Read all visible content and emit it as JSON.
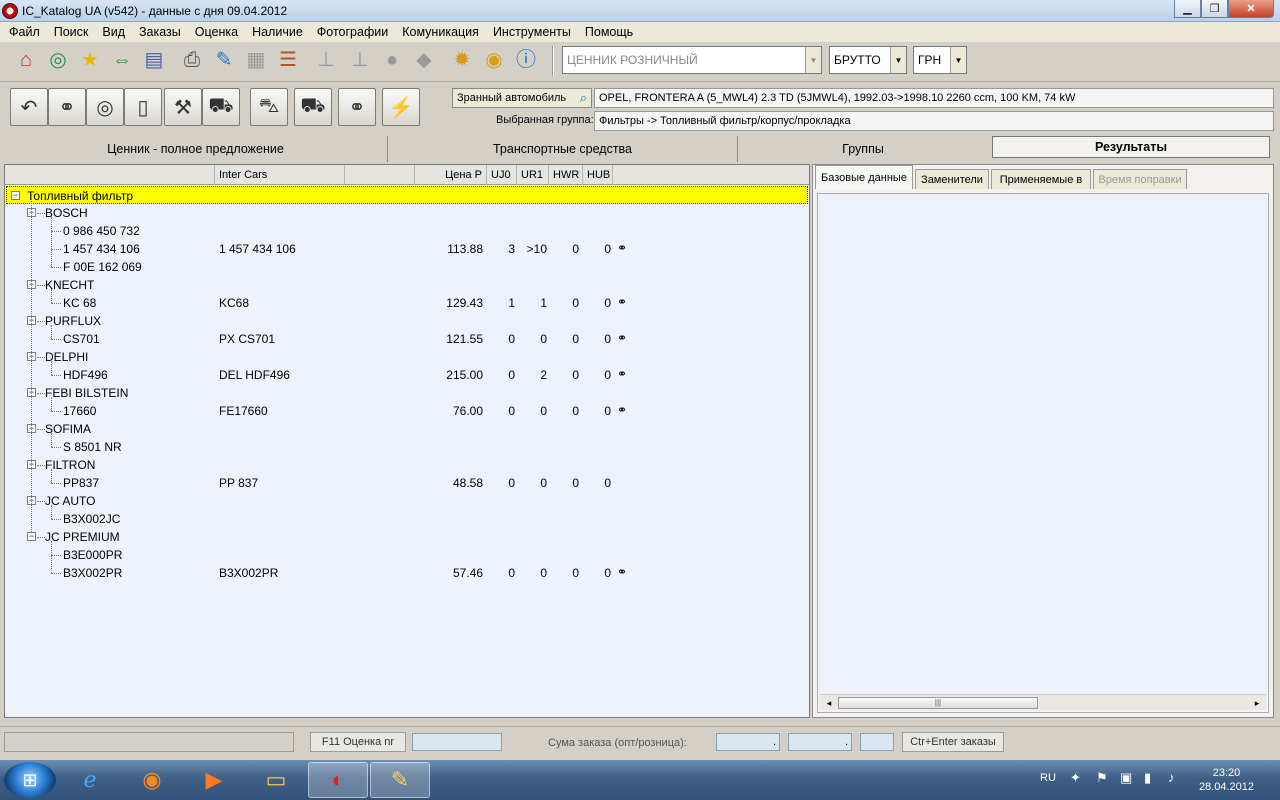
{
  "window": {
    "title": "IC_Katalog UA (v542) - данные с дня 09.04.2012"
  },
  "menu": [
    "Файл",
    "Поиск",
    "Вид",
    "Заказы",
    "Оценка",
    "Наличие",
    "Фотографии",
    "Комуникация",
    "Инструменты",
    "Помощь"
  ],
  "toolbar1": {
    "icons": [
      "home-icon",
      "refresh-globe-icon",
      "star-icon",
      "arrows-icon",
      "document-icon",
      "printer-icon",
      "pen-icon",
      "puzzle-icon",
      "notes-icon",
      "pin-icon",
      "pin-icon",
      "bubble-icon",
      "cart-icon",
      "gear-icon",
      "coins-icon",
      "info-icon"
    ],
    "price_list": "ЦЕННИК РОЗНИЧНЫЙ",
    "gross": "БРУТТО",
    "currency": "ГРН"
  },
  "vehicle": {
    "button_label": "Зранный автомобиль",
    "value": "OPEL, FRONTERA A (5_MWL4)  2.3 TD (5JMWL4), 1992.03->1998.10  2260 ccm, 100 KM, 74 kW",
    "group_label": "Выбранная группа:",
    "group_value": "Фильтры -> Топливный фильтр/корпус/прокладка"
  },
  "main_tabs": [
    "Ценник - полное предложение",
    "Транспортные средства",
    "Группы",
    "Результаты"
  ],
  "columns": {
    "c1": "",
    "inter_cars": "Inter Cars",
    "c3": "",
    "price": "Цена Р",
    "uj0": "UJ0",
    "ur1": "UR1",
    "hwr": "HWR",
    "hub": "HUB"
  },
  "tree": {
    "root": "Топливный фильтр",
    "rows": [
      {
        "type": "brand",
        "label": "BOSCH"
      },
      {
        "type": "item",
        "label": "0 986 450 732",
        "ic": "",
        "price": "",
        "uj0": "",
        "ur1": "",
        "hwr": "",
        "hub": "",
        "bino": false
      },
      {
        "type": "item",
        "label": "1 457 434 106",
        "ic": "1 457 434 106",
        "price": "113.88",
        "uj0": "3",
        "ur1": ">10",
        "hwr": "0",
        "hub": "0",
        "bino": true
      },
      {
        "type": "item",
        "label": "F 00E 162 069",
        "ic": "",
        "price": "",
        "uj0": "",
        "ur1": "",
        "hwr": "",
        "hub": "",
        "bino": false
      },
      {
        "type": "brand",
        "label": "KNECHT"
      },
      {
        "type": "item",
        "label": "KC 68",
        "ic": "KC68",
        "price": "129.43",
        "uj0": "1",
        "ur1": "1",
        "hwr": "0",
        "hub": "0",
        "bino": true
      },
      {
        "type": "brand",
        "label": "PURFLUX"
      },
      {
        "type": "item",
        "label": "CS701",
        "ic": "PX CS701",
        "price": "121.55",
        "uj0": "0",
        "ur1": "0",
        "hwr": "0",
        "hub": "0",
        "bino": true
      },
      {
        "type": "brand",
        "label": "DELPHI"
      },
      {
        "type": "item",
        "label": "HDF496",
        "ic": "DEL HDF496",
        "price": "215.00",
        "uj0": "0",
        "ur1": "2",
        "hwr": "0",
        "hub": "0",
        "bino": true
      },
      {
        "type": "brand",
        "label": "FEBI BILSTEIN"
      },
      {
        "type": "item",
        "label": "17660",
        "ic": "FE17660",
        "price": "76.00",
        "uj0": "0",
        "ur1": "0",
        "hwr": "0",
        "hub": "0",
        "bino": true
      },
      {
        "type": "brand",
        "label": "SOFIMA"
      },
      {
        "type": "item",
        "label": "S 8501 NR",
        "ic": "",
        "price": "",
        "uj0": "",
        "ur1": "",
        "hwr": "",
        "hub": "",
        "bino": false
      },
      {
        "type": "brand",
        "label": "FILTRON"
      },
      {
        "type": "item",
        "label": "PP837",
        "ic": "PP 837",
        "price": "48.58",
        "uj0": "0",
        "ur1": "0",
        "hwr": "0",
        "hub": "0",
        "bino": false
      },
      {
        "type": "brand",
        "label": "JC AUTO"
      },
      {
        "type": "item",
        "label": "B3X002JC",
        "ic": "",
        "price": "",
        "uj0": "",
        "ur1": "",
        "hwr": "",
        "hub": "",
        "bino": false
      },
      {
        "type": "brand",
        "label": "JC PREMIUM"
      },
      {
        "type": "item",
        "label": "B3E000PR",
        "ic": "",
        "price": "",
        "uj0": "",
        "ur1": "",
        "hwr": "",
        "hub": "",
        "bino": false
      },
      {
        "type": "item",
        "label": "B3X002PR",
        "ic": "B3X002PR",
        "price": "57.46",
        "uj0": "0",
        "ur1": "0",
        "hwr": "0",
        "hub": "0",
        "bino": true
      }
    ]
  },
  "right_tabs": [
    "Базовые данные",
    "Заменители",
    "Применяемые в",
    "Время поправки"
  ],
  "statusbar": {
    "f11": "F11 Оценка nr",
    "sum_label": "Сума заказа (опт/розница):",
    "sum1": ".",
    "sum2": ".",
    "order_btn": "Ctr+Enter заказы"
  },
  "taskbar": {
    "lang": "RU",
    "time": "23:20",
    "date": "28.04.2012"
  }
}
